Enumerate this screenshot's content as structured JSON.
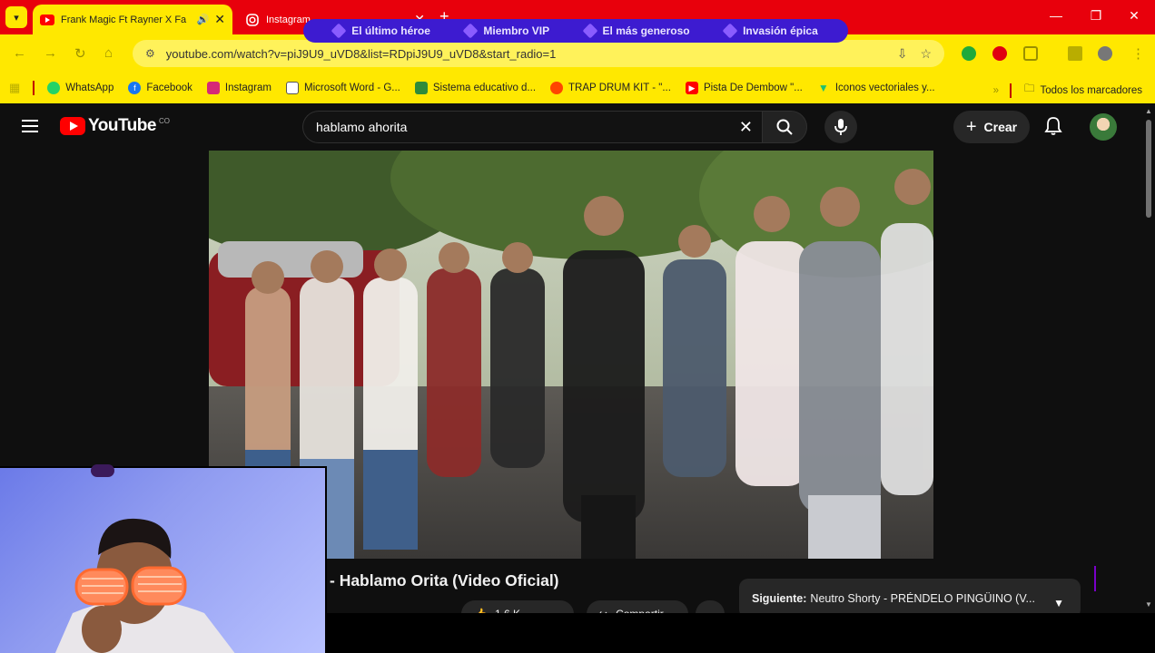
{
  "browser": {
    "tabs": [
      {
        "title": "Frank Magic Ft Rayner X Fa",
        "active": true,
        "icon": "youtube-icon"
      },
      {
        "title": "Instagram",
        "active": false,
        "icon": "instagram-icon"
      }
    ],
    "url": "youtube.com/watch?v=piJ9U9_uVD8&list=RDpiJ9U9_uVD8&start_radio=1",
    "bookmarks": [
      {
        "label": "WhatsApp",
        "icon": "whatsapp-icon",
        "color": "#25d366"
      },
      {
        "label": "Facebook",
        "icon": "facebook-icon",
        "color": "#1877f2"
      },
      {
        "label": "Instagram",
        "icon": "instagram-icon",
        "color": "#d62976"
      },
      {
        "label": "Microsoft Word - G...",
        "icon": "word-doc-icon",
        "color": "#555555"
      },
      {
        "label": "Sistema educativo d...",
        "icon": "education-icon",
        "color": "#2e8b3a"
      },
      {
        "label": "TRAP DRUM KIT - \"...",
        "icon": "reddit-icon",
        "color": "#ff4500"
      },
      {
        "label": "Pista De Dembow \"...",
        "icon": "youtube-icon",
        "color": "#ff0000"
      },
      {
        "label": "Iconos vectoriales y...",
        "icon": "vector-icon",
        "color": "#20c070"
      }
    ],
    "all_bookmarks": "Todos los marcadores"
  },
  "overlay": {
    "items": [
      "El último héroe",
      "Miembro VIP",
      "El más generoso",
      "Invasión épica"
    ]
  },
  "youtube": {
    "logo_text": "YouTube",
    "country_code": "CO",
    "search_query": "hablamo ahorita",
    "create_label": "Crear",
    "video_title": "- Hablamo Orita (Video Oficial)",
    "up_next_label": "Siguiente:",
    "up_next_title": "Neutro Shorty - PRÉNDELO PINGÜINO (V...",
    "like_count": "1.6 K",
    "share_label": "Compartir"
  },
  "colors": {
    "tabbar": "#e8000c",
    "toolbar": "#ffe800",
    "overlay": "#3d1bd0",
    "youtube_bg": "#0f0f0f",
    "brand_red": "#ff0000"
  }
}
